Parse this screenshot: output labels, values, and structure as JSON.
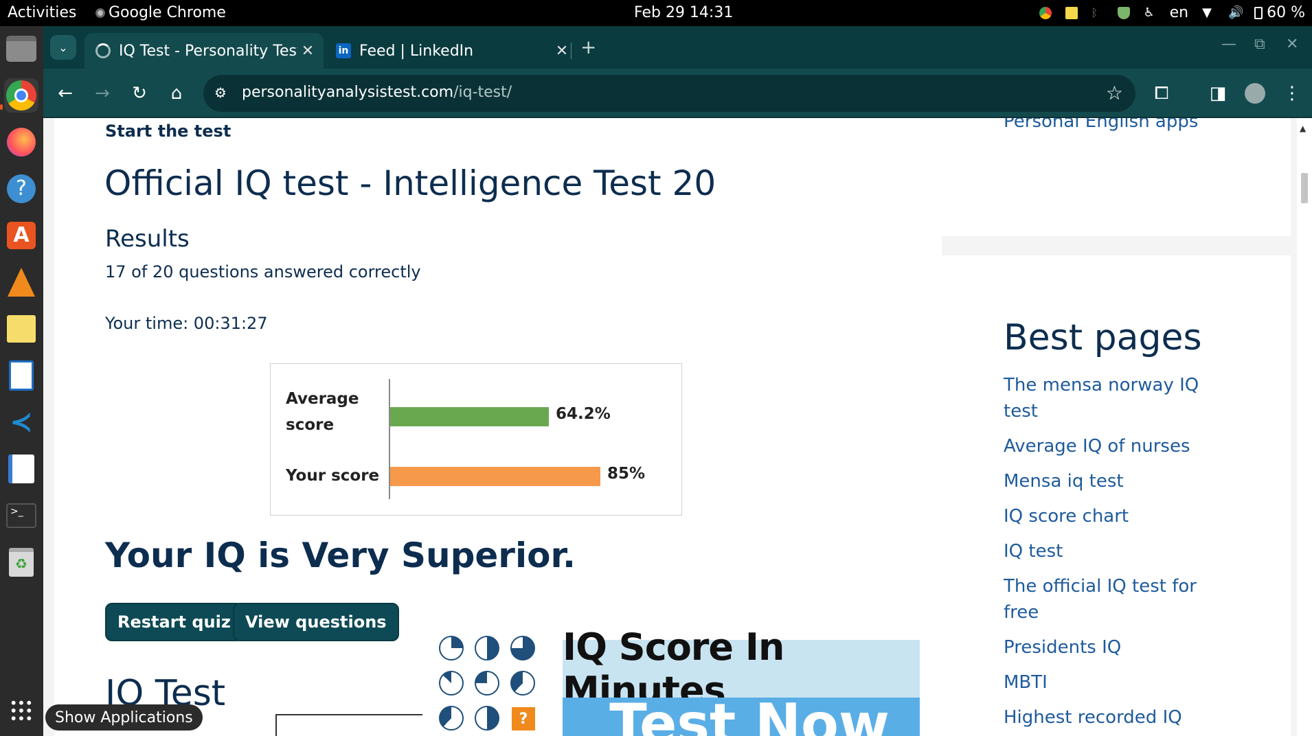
{
  "topbar": {
    "activities": "Activities",
    "app_name": "Google Chrome",
    "clock": "Feb 29  14:31",
    "language": "en",
    "battery": "60 %"
  },
  "dock": {
    "show_apps_tooltip": "Show Applications",
    "items": [
      "files-icon",
      "chrome-icon",
      "firefox-icon",
      "help-icon",
      "software-icon",
      "vlc-icon",
      "notes-icon",
      "writer-icon",
      "vscode-icon",
      "text-editor-icon",
      "terminal-icon",
      "trash-icon",
      "app-grid-icon"
    ]
  },
  "browser": {
    "tabs": [
      {
        "title": "IQ Test - Personality Test",
        "active": true
      },
      {
        "title": "Feed | LinkedIn",
        "active": false
      }
    ],
    "url_domain": "personalityanalysistest.com",
    "url_path": "/iq-test/"
  },
  "page": {
    "start_label": "Start the test",
    "heading": "Official IQ test - Intelligence Test 20",
    "results_heading": "Results",
    "answered": "17 of 20 questions answered correctly",
    "time": "Your time: 00:31:27",
    "verdict": "Your IQ is Very Superior.",
    "restart_button": "Restart quiz",
    "view_button": "View questions",
    "section_heading": "IQ Test"
  },
  "chart_data": {
    "type": "bar",
    "orientation": "horizontal",
    "categories": [
      "Average score",
      "Your score"
    ],
    "values": [
      64.2,
      85
    ],
    "value_labels": [
      "64.2%",
      "85%"
    ],
    "colors": [
      "#6aa84f",
      "#f6994a"
    ],
    "xlim": [
      0,
      100
    ]
  },
  "ad": {
    "line1": "IQ Score In Minutes",
    "line2": "Test Now",
    "close": "x",
    "puzzle_mark": "?"
  },
  "sidebar": {
    "top_link": "Personal English apps",
    "heading": "Best pages",
    "links": [
      "The mensa norway IQ test",
      "Average IQ of nurses",
      "Mensa iq test",
      "IQ score chart",
      "IQ test",
      "The official IQ test for free",
      "Presidents IQ",
      "MBTI",
      "Highest recorded IQ"
    ]
  }
}
